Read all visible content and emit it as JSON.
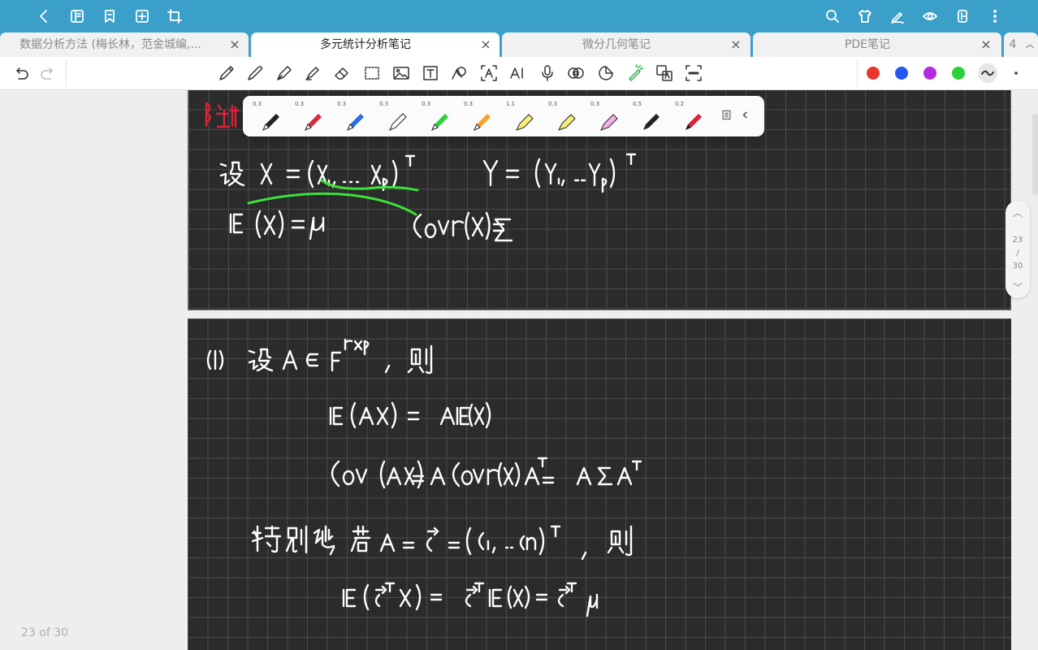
{
  "tabs": [
    {
      "label": "数据分析方法 (梅长林，范金城编,...",
      "close": "×"
    },
    {
      "label": "多元统计分析笔记",
      "close": "×"
    },
    {
      "label": "微分几何笔记",
      "close": "×"
    },
    {
      "label": "PDE笔记",
      "close": "×"
    },
    {
      "label": "4"
    }
  ],
  "pen_presets": [
    "0.3",
    "0.3",
    "0.3",
    "0.3",
    "0.3",
    "0.3",
    "1.1",
    "0.3",
    "0.3",
    "0.5",
    "0.2"
  ],
  "colors": {
    "accent": "#3a9fc9",
    "palette": [
      "#e8362a",
      "#2457f0",
      "#b22be0",
      "#2bd13a"
    ]
  },
  "scroll": {
    "current": "23",
    "slash": "/",
    "total": "30"
  },
  "page_indicator": "23 of 30",
  "icons": {
    "topbar_left": [
      "back-icon",
      "notebook-icon",
      "bookmark-icon",
      "add-page-icon",
      "crop-icon"
    ],
    "topbar_right": [
      "search-icon",
      "shirt-icon",
      "pen-sign-icon",
      "eye-icon",
      "phone-layout-icon",
      "more-vertical-icon"
    ],
    "toolbar": [
      "undo-icon",
      "redo-icon",
      "pencil-icon",
      "pen-icon",
      "fountain-pen-icon",
      "highlighter-icon",
      "eraser-icon",
      "lasso-select-icon",
      "image-icon",
      "text-box-icon",
      "shape-icon",
      "text-recognize-icon",
      "ai-icon",
      "microphone-icon",
      "link-icon",
      "sticker-icon",
      "laser-pointer-icon",
      "translate-icon",
      "ocr-icon"
    ]
  }
}
